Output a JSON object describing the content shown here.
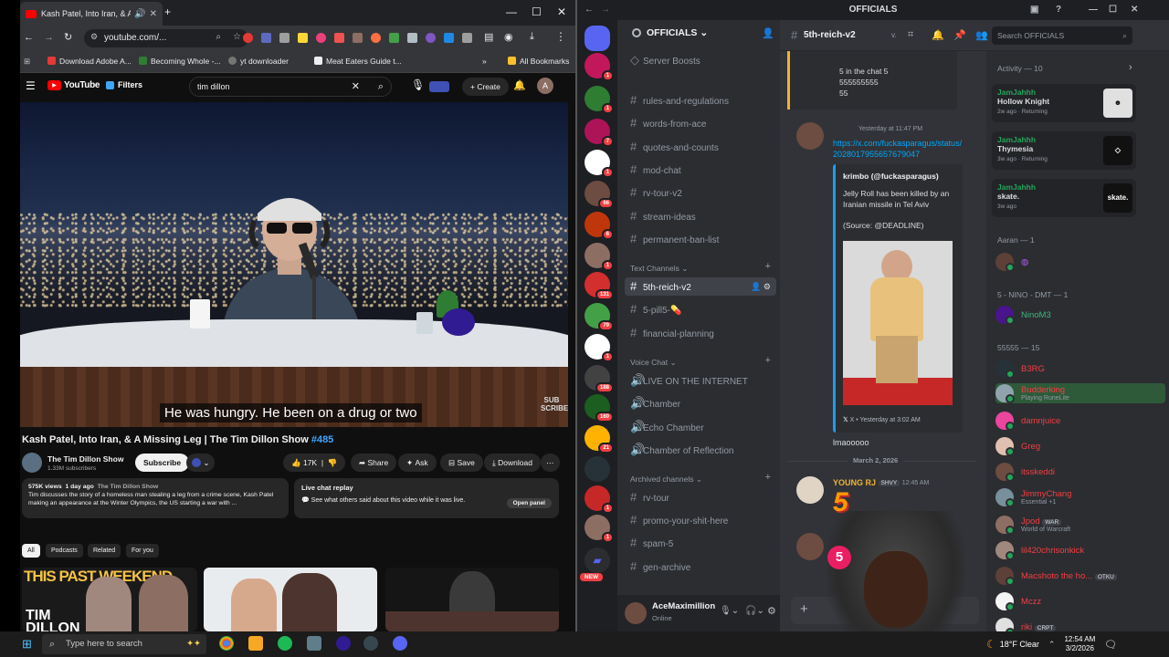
{
  "chrome": {
    "tab_title": "Kash Patel, Into Iran, & A Mi",
    "url": "youtube.com/...",
    "bookmarks": [
      "Download Adobe A...",
      "Becoming Whole -...",
      "yt downloader",
      "Meat Eaters Guide t..."
    ],
    "all_bookmarks": "All Bookmarks"
  },
  "youtube": {
    "logo": "YouTube",
    "filters": "Filters",
    "search_query": "tim dillon",
    "create_label": "Create",
    "avatar_letter": "A",
    "subtitle": "He was hungry. He been on a drug or two",
    "watermark": "SUB SCRIBE",
    "title": "Kash Patel, Into Iran, & A Missing Leg | The Tim Dillon Show",
    "title_tag": "#485",
    "channel_name": "The Tim Dillon Show",
    "subscribers": "1.33M subscribers",
    "subscribe": "Subscribe",
    "likes": "17K",
    "share": "Share",
    "ask": "Ask",
    "save": "Save",
    "download": "Download",
    "views": "575K views",
    "age": "1 day ago",
    "desc_channel": "The Tim Dillon Show",
    "desc_text": "Tim discusses the story of a homeless man stealing a leg from a crime scene, Kash Patel making an appearance at the Winter Olympics, the US starting a war with ...",
    "more": "...more",
    "chat_title": "Live chat replay",
    "chat_text": "See what others said about this video while it was live.",
    "open_panel": "Open panel",
    "chips": [
      "All",
      "Podcasts",
      "Related",
      "For you"
    ],
    "thumb1_text": "THIS PAST WEEKEND",
    "thumb1_sub": "TIM DILLON"
  },
  "discord": {
    "window_title": "OFFICIALS",
    "server_name": "OFFICIALS",
    "server_boosts": "Server Boosts",
    "channels_top": [
      "rules-and-regulations",
      "words-from-ace",
      "quotes-and-counts",
      "mod-chat",
      "rv-tour-v2",
      "stream-ideas",
      "permanent-ban-list"
    ],
    "text_channels_label": "Text Channels",
    "text_channels": [
      "5th-reich-v2",
      "5-pill5-💊",
      "financial-planning"
    ],
    "voice_chat_label": "Voice Chat",
    "voice_channels": [
      "LIVE ON THE INTERNET",
      "Chamber",
      "Echo Chamber",
      "Chamber of Reflection"
    ],
    "archived_label": "Archived channels",
    "archived_channels": [
      "rv-tour",
      "promo-your-shit-here",
      "spam-5",
      "gen-archive"
    ],
    "new_badge": "NEW",
    "user_name": "AceMaximillion",
    "user_status": "Online",
    "channel_header": "5th-reich-v2",
    "search_placeholder": "Search OFFICIALS",
    "server_badges": [
      "1",
      "1",
      "7",
      "1",
      "",
      "66",
      "6",
      "1",
      "131",
      "79",
      "1",
      "188",
      "160",
      "21",
      "",
      "1",
      "1",
      ""
    ],
    "messages": {
      "top_lines": [
        "5 in the chat 5",
        "555555555",
        "55"
      ],
      "ts1": "Yesterday at 11:47 PM",
      "link": "https://x.com/fuckasparagus/status/2028017955657679047",
      "embed_author": "krimbo (@fuckasparagus)",
      "embed_text": "Jelly Roll has been killed by an Iranian missile in Tel Aviv",
      "embed_source": "(Source: @DEADLINE)",
      "embed_footer": "X • Yesterday at 3:02 AM",
      "reply1": "lmaooooo",
      "date_divider": "March 2, 2026",
      "user2": "YOUNG RJ",
      "user2_tag": "SHVY",
      "ts2": "12:45 AM",
      "big5": "5"
    },
    "activity_label": "Activity — 10",
    "activity": [
      {
        "user": "JamJahhh",
        "game": "Hollow Knight",
        "time": "2w ago · Returning"
      },
      {
        "user": "JamJahhh",
        "game": "Thymesia",
        "time": "3w ago · Returning"
      },
      {
        "user": "JamJahhh",
        "game": "skate.",
        "time": "3w ago",
        "img": "skate."
      }
    ],
    "groups": [
      {
        "label": "Aaran — 1"
      },
      {
        "label": "5 - NINO - DMT — 1",
        "member": "NinoM3"
      },
      {
        "label": "55555 — 15"
      }
    ],
    "members": [
      {
        "name": "B3RG",
        "sub": "",
        "color": "#f23f43"
      },
      {
        "name": "Budderking",
        "sub": "Playing RuneLite",
        "color": "#f23f43"
      },
      {
        "name": "damnjuice",
        "sub": "",
        "color": "#f23f43"
      },
      {
        "name": "Greg",
        "sub": "",
        "color": "#f23f43"
      },
      {
        "name": "itsskeddi",
        "sub": "",
        "color": "#f23f43"
      },
      {
        "name": "JimmyChang",
        "sub": "Essential +1",
        "color": "#f23f43"
      },
      {
        "name": "Jpod",
        "sub": "World of Warcraft",
        "tag": "WAR",
        "color": "#f23f43"
      },
      {
        "name": "lil420chrisonkick",
        "sub": "",
        "color": "#f23f43"
      },
      {
        "name": "Macshoto the ho...",
        "sub": "",
        "tag": "OTKU",
        "color": "#f23f43"
      },
      {
        "name": "Mczz",
        "sub": "",
        "color": "#f23f43"
      },
      {
        "name": "riki",
        "sub": "",
        "tag": "CRPT",
        "color": "#f23f43"
      }
    ]
  },
  "taskbar": {
    "search_placeholder": "Type here to search",
    "weather": "18°F  Clear",
    "time": "12:54 AM",
    "date": "3/2/2026"
  }
}
